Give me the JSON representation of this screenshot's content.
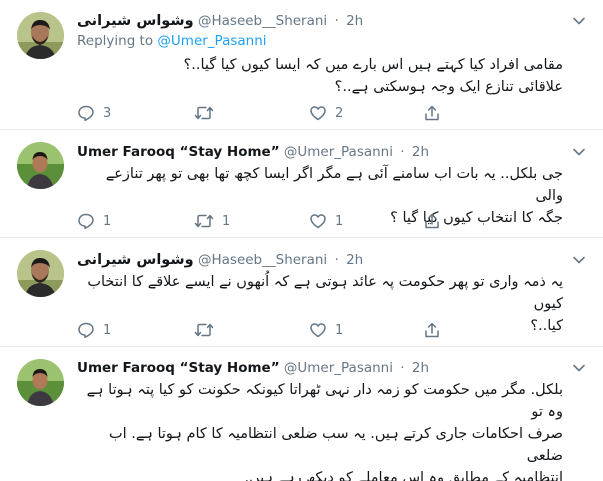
{
  "tweets": [
    {
      "author": "وشواس شیرانی",
      "handle": "@Haseeb__Sherani",
      "separator": "·",
      "time": "2h",
      "reply_prefix": "Replying to",
      "reply_mention": "@Umer_Pasanni",
      "lines": [
        "مقامی افراد کیا کہتے ہیں اس بارے میں کہ ایسا کیوں کیا گیا..؟",
        "علاقائی تنازع ایک وجہ ہوسکتی ہے..؟"
      ],
      "replies": "3",
      "retweets": "",
      "likes": "2",
      "avatar": "bearded-man-outdoor"
    },
    {
      "author": "Umer Farooq “Stay Home”",
      "handle": "@Umer_Pasanni",
      "separator": "·",
      "time": "2h",
      "lines": [
        "جی بلکل.. یہ بات اب سامنے آئی ہے مگر اگر ایسا کچھ تھا بھی تو پھر تنازعے والی",
        "جگہ کا انتخاب کیوں کیا گیا ؟"
      ],
      "replies": "1",
      "retweets": "1",
      "likes": "1",
      "avatar": "man-green-field"
    },
    {
      "author": "وشواس شیرانی",
      "handle": "@Haseeb__Sherani",
      "separator": "·",
      "time": "2h",
      "lines": [
        "یہ ذمہ واری تو پھر حکومت پہ عائد ہوتی ہے کہ اُنھوں نے ایسے علاقے کا انتخاب کیوں",
        "کیا..؟"
      ],
      "replies": "1",
      "retweets": "",
      "likes": "1",
      "avatar": "bearded-man-outdoor"
    },
    {
      "author": "Umer Farooq “Stay Home”",
      "handle": "@Umer_Pasanni",
      "separator": "·",
      "time": "2h",
      "lines": [
        "بلکل. مگر میں حکومت کو زمہ دار نہی ٹھراتا کیونکہ حکونت کو کیا پتہ ہوتا ہے وہ تو",
        "صرف احکامات جاری کرتے ہیں. یہ سب ضلعی انتظامیہ کا کام ہوتا ہے. اب ضلعی",
        "انتظامیہ کے مطابق وہ اس معاملے کو دیکھ رہے ہیں."
      ],
      "replies": "",
      "retweets": "",
      "likes": "",
      "avatar": "man-green-field"
    }
  ],
  "colors": {
    "text": "#14171a",
    "secondary": "#657786",
    "link": "#1da1f2",
    "divider": "#e6ecf0"
  },
  "icons": [
    "chevron-down-icon",
    "reply-icon",
    "retweet-icon",
    "like-icon",
    "share-icon"
  ]
}
